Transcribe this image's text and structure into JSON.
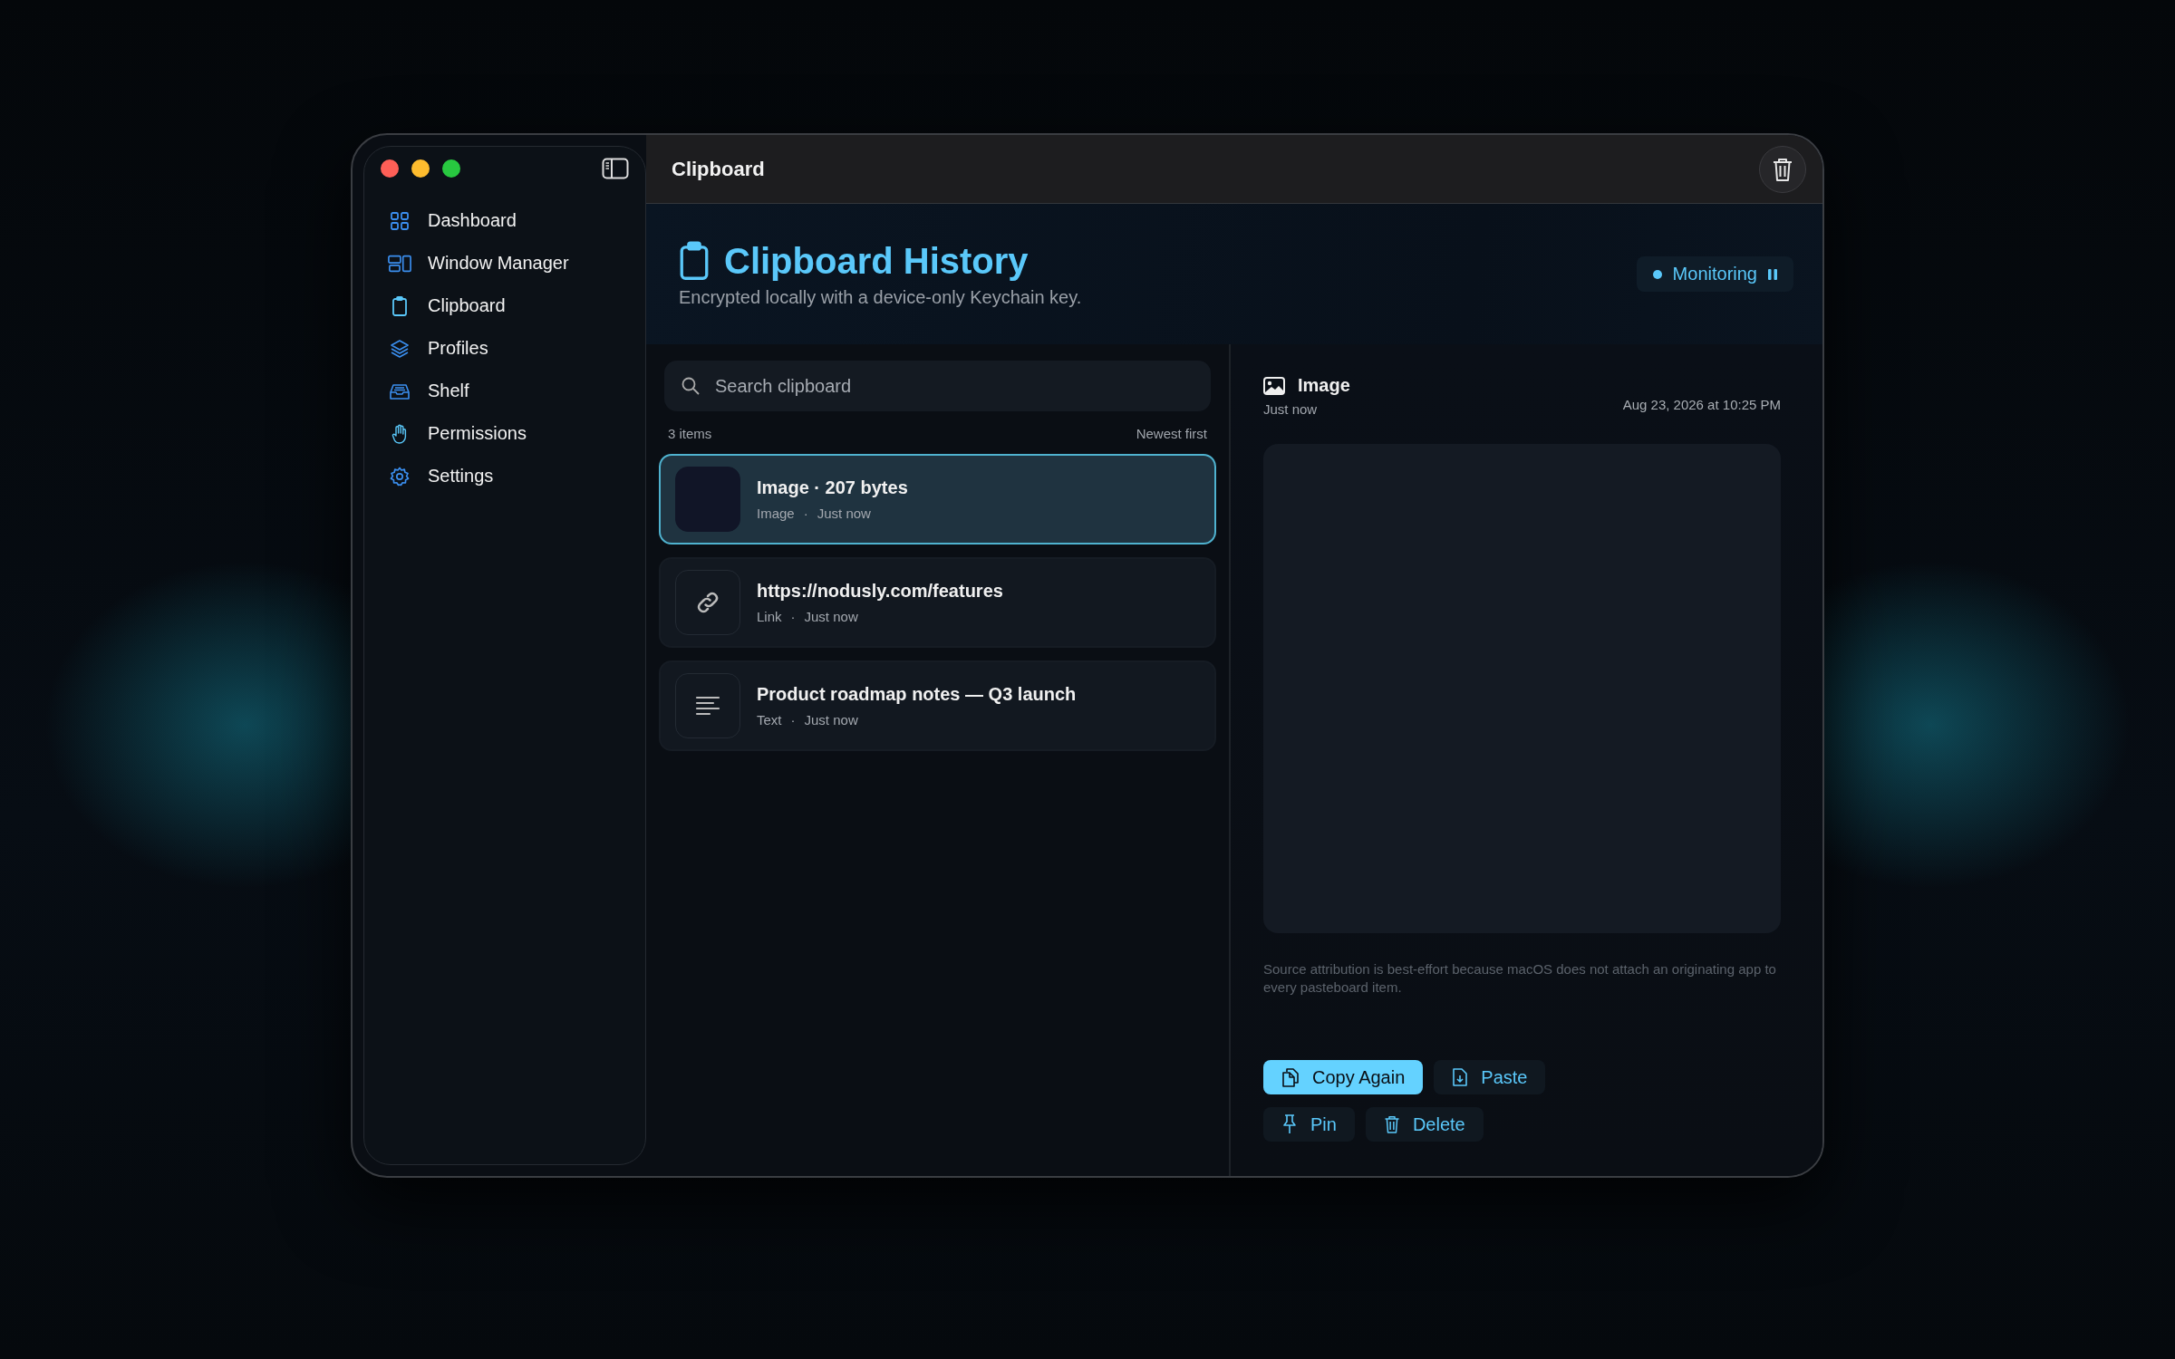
{
  "window": {
    "title": "Clipboard"
  },
  "sidebar": {
    "items": [
      {
        "label": "Dashboard"
      },
      {
        "label": "Window Manager"
      },
      {
        "label": "Clipboard"
      },
      {
        "label": "Profiles"
      },
      {
        "label": "Shelf"
      },
      {
        "label": "Permissions"
      },
      {
        "label": "Settings"
      }
    ]
  },
  "header": {
    "title": "Clipboard History",
    "subtitle": "Encrypted locally with a device-only Keychain key.",
    "status": "Monitoring"
  },
  "search": {
    "placeholder": "Search clipboard"
  },
  "list": {
    "count": "3 items",
    "sort": "Newest first",
    "items": [
      {
        "kind": "image",
        "title": "Image · 207 bytes",
        "type": "Image",
        "sep": "·",
        "time": "Just now",
        "selected": true
      },
      {
        "kind": "link",
        "title": "https://nodusly.com/features",
        "type": "Link",
        "sep": "·",
        "time": "Just now",
        "selected": false
      },
      {
        "kind": "text",
        "title": "Product roadmap notes — Q3 launch",
        "type": "Text",
        "sep": "·",
        "time": "Just now",
        "selected": false
      }
    ]
  },
  "detail": {
    "title": "Image",
    "time": "Just now",
    "date": "Aug 23, 2026 at 10:25 PM",
    "note": "Source attribution is best-effort because macOS does not attach an originating app to every pasteboard item.",
    "action_rows": [
      [
        {
          "label": "Copy Again",
          "kind": "primary"
        },
        {
          "label": "Paste",
          "kind": "secondary"
        }
      ],
      [
        {
          "label": "Pin",
          "kind": "secondary"
        },
        {
          "label": "Delete",
          "kind": "secondary"
        }
      ]
    ]
  }
}
